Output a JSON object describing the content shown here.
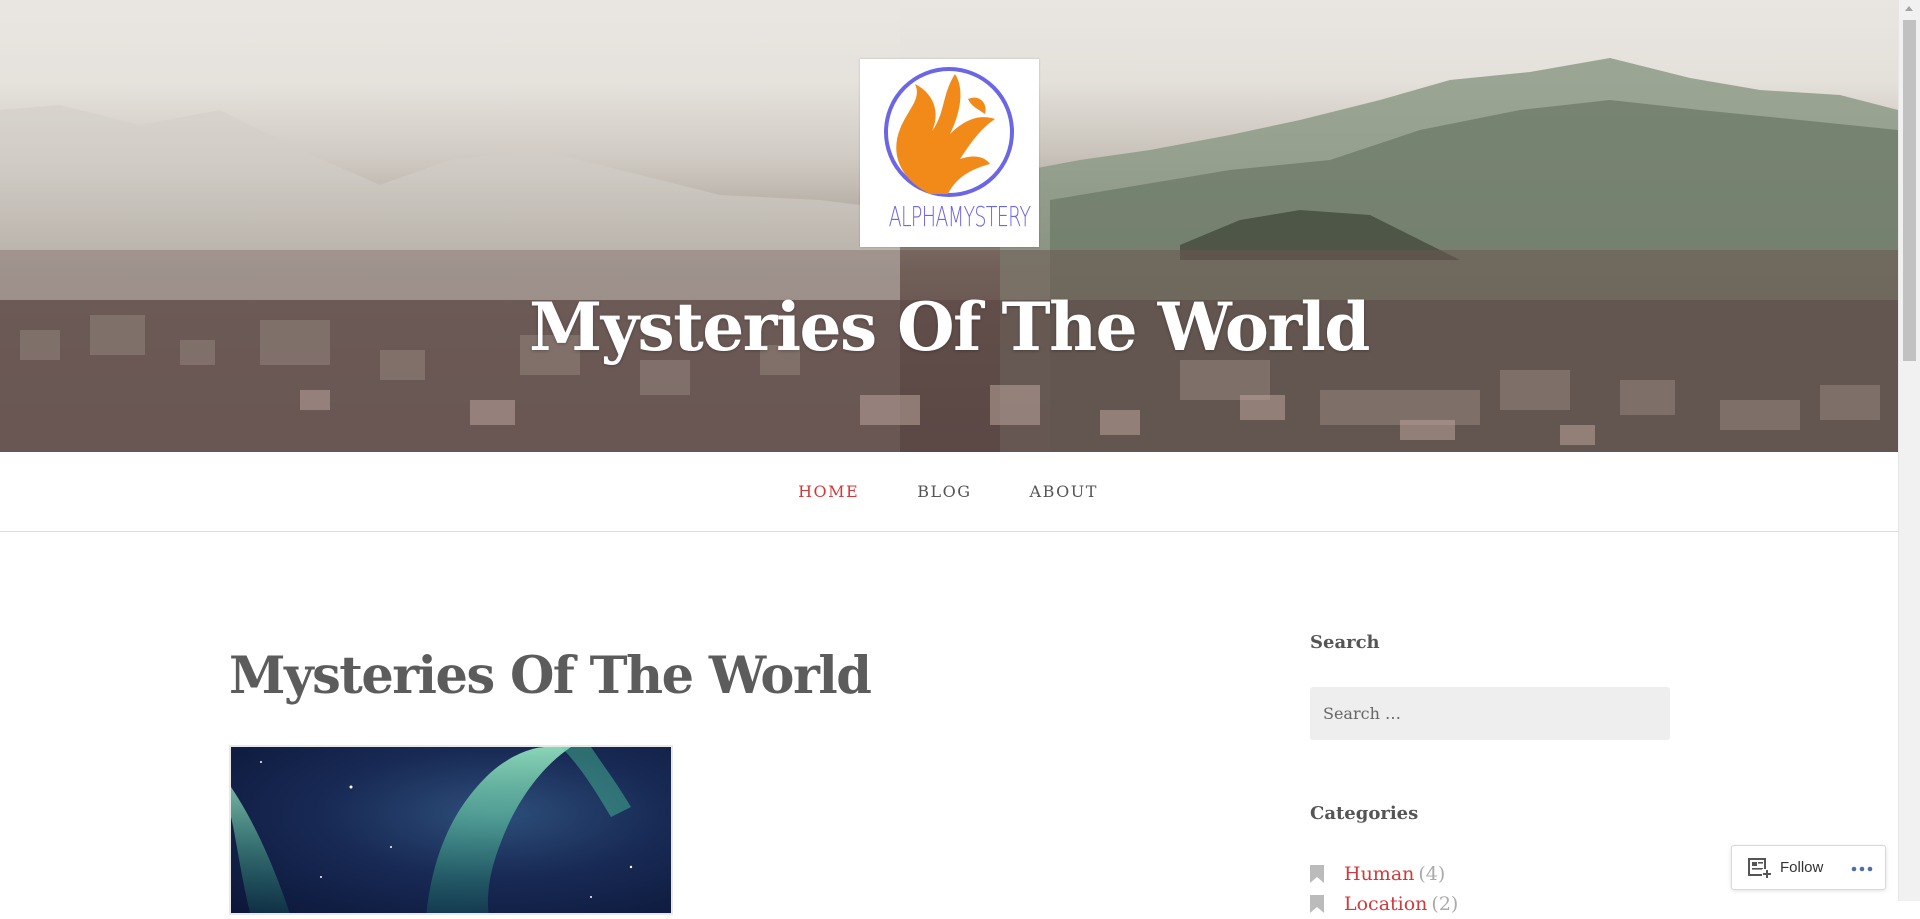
{
  "header": {
    "logo_text": "ALPHAMYSTERY",
    "site_title": "Mysteries Of The World"
  },
  "nav": {
    "items": [
      {
        "label": "HOME",
        "active": true
      },
      {
        "label": "BLOG",
        "active": false
      },
      {
        "label": "ABOUT",
        "active": false
      }
    ]
  },
  "main": {
    "page_title": "Mysteries Of The World"
  },
  "sidebar": {
    "search_title": "Search",
    "search_placeholder": "Search …",
    "categories_title": "Categories",
    "categories": [
      {
        "label": "Human",
        "count": "(4)"
      },
      {
        "label": "Location",
        "count": "(2)"
      }
    ]
  },
  "follow_widget": {
    "label": "Follow",
    "icon": "reader-follow-icon",
    "more_icon": "more-dots-icon"
  },
  "colors": {
    "accent": "#d13a3a",
    "logo_purple": "#6b66e6",
    "logo_orange": "#f28a1a"
  }
}
